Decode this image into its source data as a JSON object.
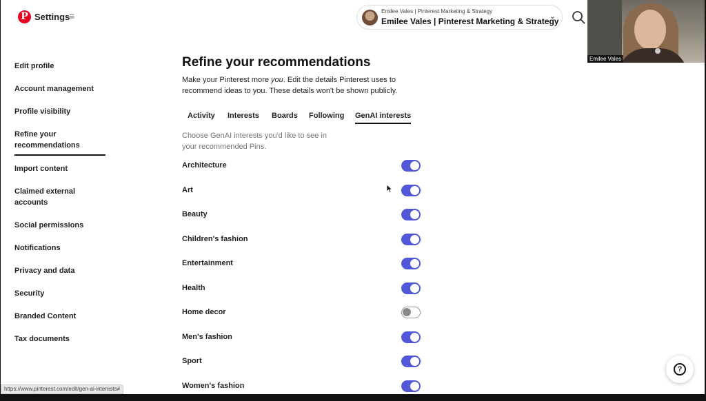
{
  "header": {
    "logo_letter": "P",
    "title": "Settings",
    "menu_icon": "≡",
    "account": {
      "subtitle": "Emilee Vales | Pinterest Marketing & Strategy",
      "name": "Emilee Vales | Pinterest Marketing & Strategy",
      "chevron": "⌄"
    }
  },
  "video_overlay": {
    "name": "Emilee Vales"
  },
  "sidebar": {
    "items": [
      {
        "label": "Edit profile"
      },
      {
        "label": "Account management"
      },
      {
        "label": "Profile visibility"
      },
      {
        "label": "Refine your recommendations"
      },
      {
        "label": "Import content"
      },
      {
        "label": "Claimed external accounts"
      },
      {
        "label": "Social permissions"
      },
      {
        "label": "Notifications"
      },
      {
        "label": "Privacy and data"
      },
      {
        "label": "Security"
      },
      {
        "label": "Branded Content"
      },
      {
        "label": "Tax documents"
      }
    ],
    "active_index": 3
  },
  "main": {
    "title": "Refine your recommendations",
    "desc_prefix": "Make your Pinterest more ",
    "desc_em": "you",
    "desc_suffix": ". Edit the details Pinterest uses to recommend ideas to you. These details won't be shown publicly.",
    "tabs": [
      {
        "label": "Activity"
      },
      {
        "label": "Interests"
      },
      {
        "label": "Boards"
      },
      {
        "label": "Following"
      },
      {
        "label": "GenAI interests"
      }
    ],
    "active_tab": 4,
    "hint": "Choose GenAI interests you'd like to see in your recommended Pins.",
    "interests": [
      {
        "label": "Architecture",
        "enabled": true
      },
      {
        "label": "Art",
        "enabled": true
      },
      {
        "label": "Beauty",
        "enabled": true
      },
      {
        "label": "Children's fashion",
        "enabled": true
      },
      {
        "label": "Entertainment",
        "enabled": true
      },
      {
        "label": "Health",
        "enabled": true
      },
      {
        "label": "Home decor",
        "enabled": false
      },
      {
        "label": "Men's fashion",
        "enabled": true
      },
      {
        "label": "Sport",
        "enabled": true
      },
      {
        "label": "Women's fashion",
        "enabled": true
      }
    ]
  },
  "help": {
    "label": "?"
  },
  "status_bar": {
    "url": "https://www.pinterest.com/edit/gen-ai-interests#"
  },
  "colors": {
    "brand": "#e60023",
    "toggle_on": "#5058d8",
    "toggle_off_knob": "#8a8a8a"
  }
}
